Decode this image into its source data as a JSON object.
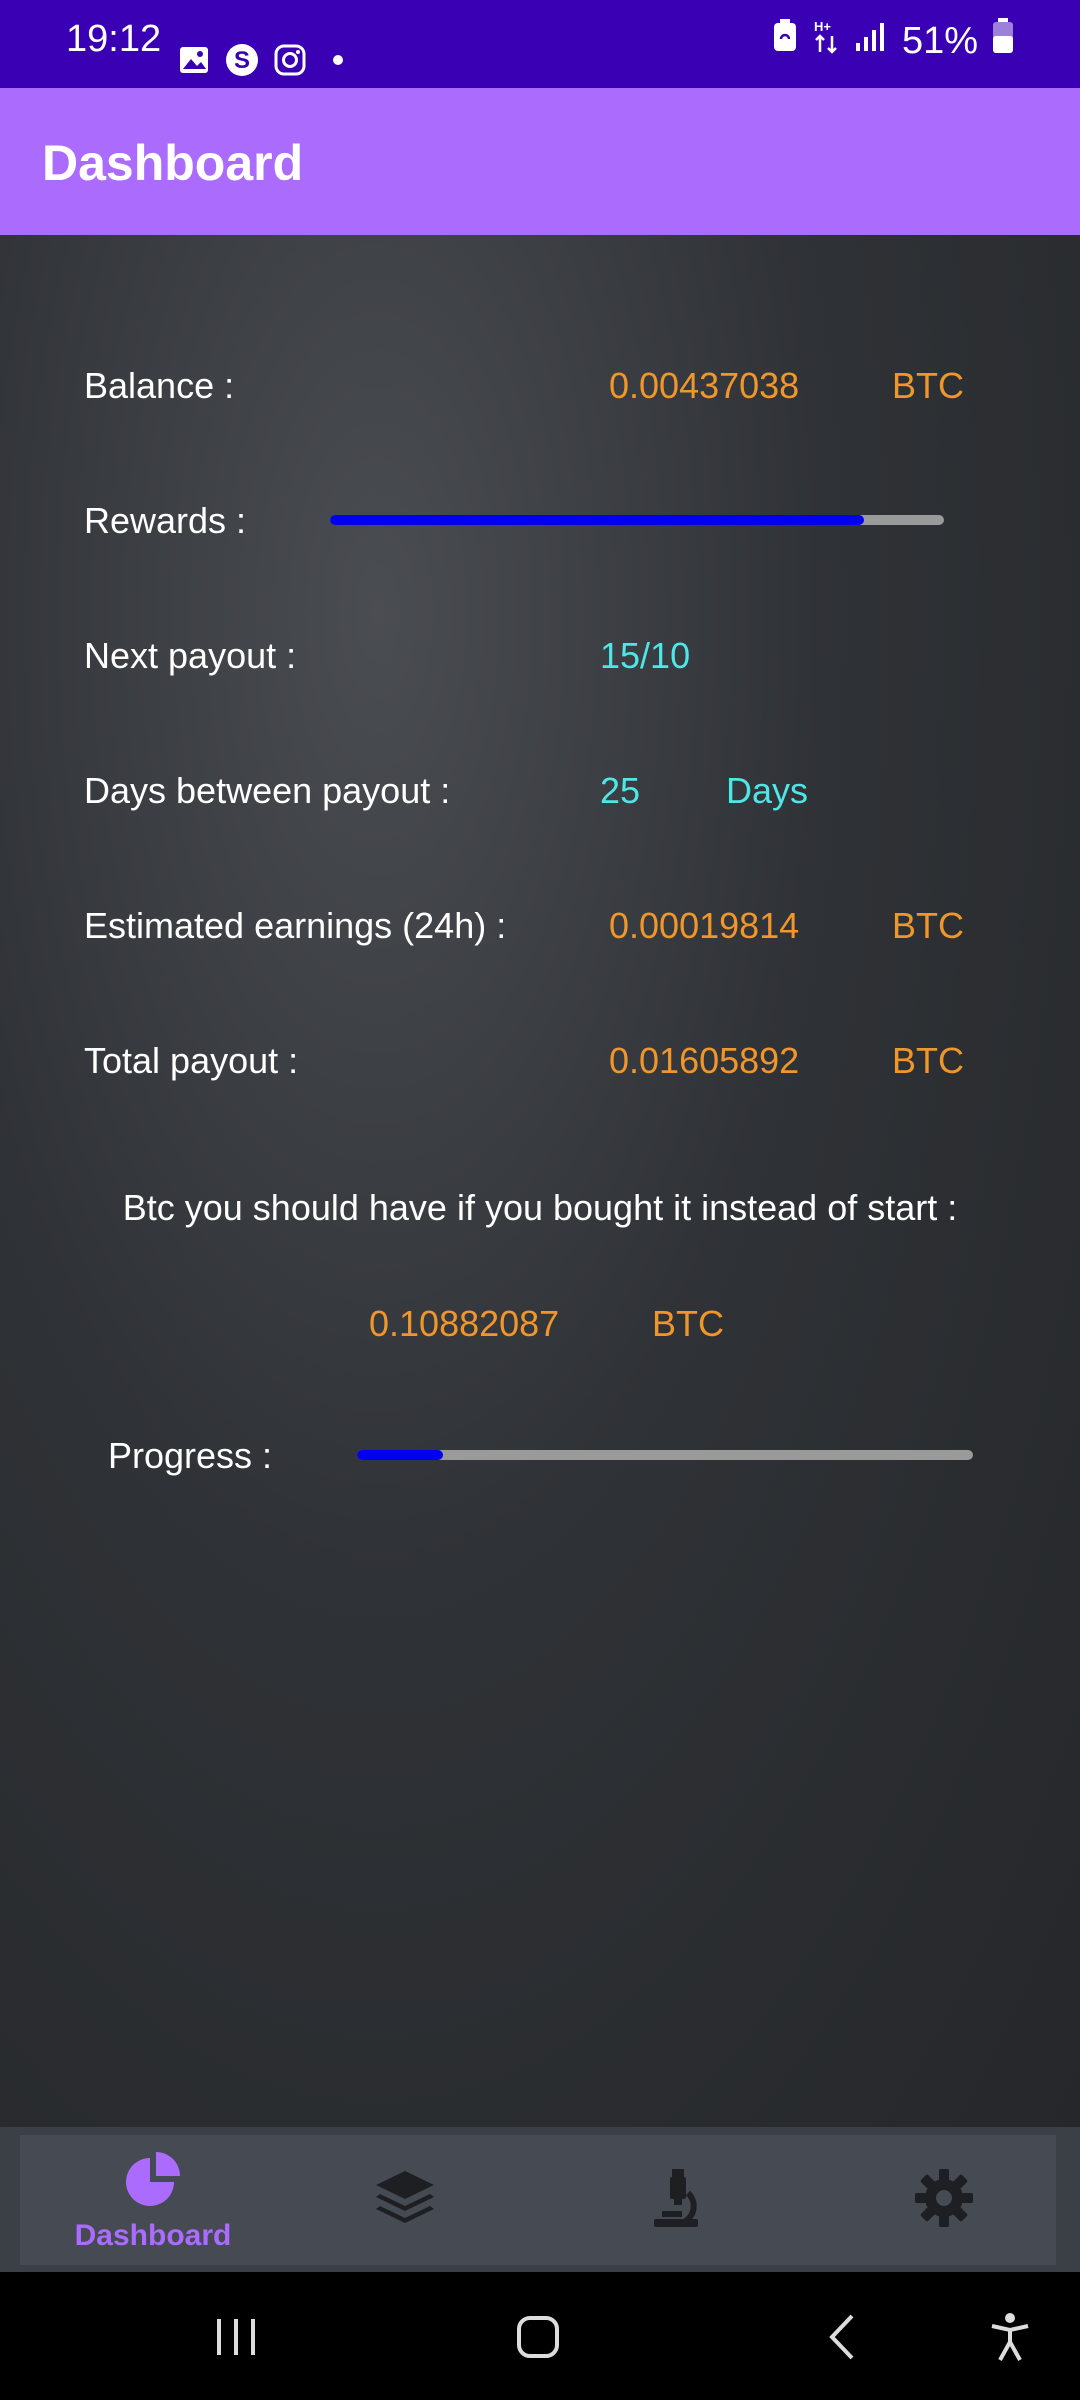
{
  "status_bar": {
    "time": "19:12",
    "battery": "51%",
    "icons": [
      "gallery-icon",
      "shazam-icon",
      "instagram-icon",
      "dot-icon",
      "battery-saver-icon",
      "data-arrows-icon",
      "signal-icon",
      "battery-icon"
    ]
  },
  "app_bar": {
    "title": "Dashboard"
  },
  "stats": {
    "balance": {
      "label": "Balance :",
      "value": "0.00437038",
      "unit": "BTC"
    },
    "rewards": {
      "label": "Rewards :",
      "progress": 0.87
    },
    "next_payout": {
      "label": "Next payout :",
      "value": "15/10"
    },
    "days_between": {
      "label": "Days between payout :",
      "value": "25",
      "unit": "Days"
    },
    "estimated": {
      "label": "Estimated earnings (24h) :",
      "value": "0.00019814",
      "unit": "BTC"
    },
    "total": {
      "label": "Total payout :",
      "value": "0.01605892",
      "unit": "BTC"
    }
  },
  "comparison": {
    "text": "Btc you should have if you bought it instead of start :",
    "value": "0.10882087",
    "unit": "BTC",
    "progress_label": "Progress :",
    "progress": 0.14
  },
  "bottom_nav": {
    "items": [
      {
        "label": "Dashboard",
        "icon": "pie-chart-icon",
        "active": true
      },
      {
        "label": "",
        "icon": "layers-icon",
        "active": false
      },
      {
        "label": "",
        "icon": "microscope-icon",
        "active": false
      },
      {
        "label": "",
        "icon": "gear-icon",
        "active": false
      }
    ]
  },
  "colors": {
    "status_bar": "#3a00b4",
    "app_bar": "#ab6cfe",
    "accent_orange": "#f0962a",
    "accent_cyan": "#4ee6e6",
    "progress_fill": "#0000ee"
  }
}
